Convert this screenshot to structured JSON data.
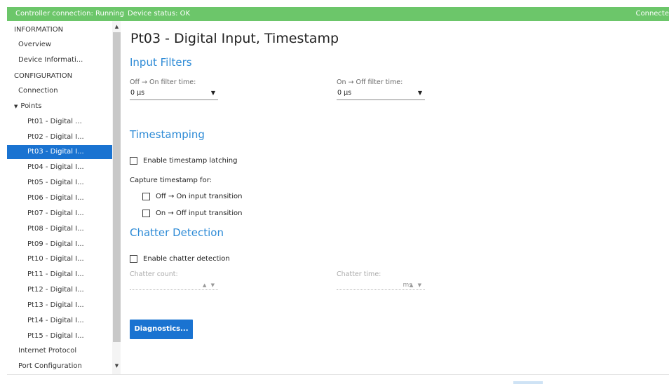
{
  "status_bar": {
    "controller_connection": "Controller connection: Running",
    "device_status": "Device status: OK",
    "right_text": "Connecte"
  },
  "sidebar": {
    "items": [
      {
        "label": "INFORMATION",
        "kind": "header"
      },
      {
        "label": "Overview",
        "kind": "l1"
      },
      {
        "label": "Device Informati...",
        "kind": "l1"
      },
      {
        "label": "CONFIGURATION",
        "kind": "header"
      },
      {
        "label": "Connection",
        "kind": "l1"
      },
      {
        "label": "Points",
        "kind": "group",
        "expanded": true
      },
      {
        "label": "Pt01 - Digital ...",
        "kind": "l2"
      },
      {
        "label": "Pt02 - Digital I...",
        "kind": "l2"
      },
      {
        "label": "Pt03 - Digital I...",
        "kind": "l2",
        "selected": true
      },
      {
        "label": "Pt04 - Digital I...",
        "kind": "l2"
      },
      {
        "label": "Pt05 - Digital I...",
        "kind": "l2"
      },
      {
        "label": "Pt06 - Digital I...",
        "kind": "l2"
      },
      {
        "label": "Pt07 - Digital I...",
        "kind": "l2"
      },
      {
        "label": "Pt08 - Digital I...",
        "kind": "l2"
      },
      {
        "label": "Pt09 - Digital I...",
        "kind": "l2"
      },
      {
        "label": "Pt10 - Digital I...",
        "kind": "l2"
      },
      {
        "label": "Pt11 - Digital I...",
        "kind": "l2"
      },
      {
        "label": "Pt12 - Digital I...",
        "kind": "l2"
      },
      {
        "label": "Pt13 - Digital I...",
        "kind": "l2"
      },
      {
        "label": "Pt14 - Digital I...",
        "kind": "l2"
      },
      {
        "label": "Pt15 - Digital I...",
        "kind": "l2"
      },
      {
        "label": "Internet Protocol",
        "kind": "l1"
      },
      {
        "label": "Port Configuration",
        "kind": "l1"
      }
    ]
  },
  "main": {
    "title": "Pt03 - Digital Input, Timestamp",
    "input_filters": {
      "title": "Input Filters",
      "off_on_label": "Off → On filter time:",
      "off_on_value": "0 µs",
      "on_off_label": "On → Off filter time:",
      "on_off_value": "0 µs"
    },
    "timestamping": {
      "title": "Timestamping",
      "enable_label": "Enable timestamp latching",
      "enable_checked": false,
      "capture_label": "Capture timestamp for:",
      "off_on_transition": "Off → On input transition",
      "off_on_checked": false,
      "on_off_transition": "On → Off input transition",
      "on_off_checked": false
    },
    "chatter": {
      "title": "Chatter Detection",
      "enable_label": "Enable chatter detection",
      "enable_checked": false,
      "count_label": "Chatter count:",
      "count_value": "",
      "time_label": "Chatter time:",
      "time_value": "",
      "time_unit": "ms"
    },
    "diagnostics_button": "Diagnostics..."
  },
  "colors": {
    "status_bar": "#6cc66a",
    "accent": "#1a73d1",
    "section_title": "#2e8bd6"
  }
}
